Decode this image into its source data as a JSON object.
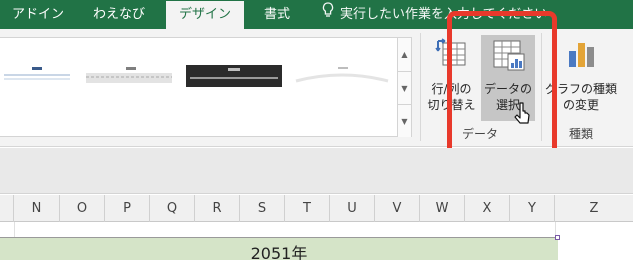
{
  "tabs": [
    {
      "label": "アドイン"
    },
    {
      "label": "わえなび"
    },
    {
      "label": "デザイン"
    },
    {
      "label": "書式"
    }
  ],
  "tell_me": "実行したい作業を入力してください",
  "ribbon": {
    "switch_row_col": "行/列の\n切り替え",
    "select_data": "データの\n選択",
    "change_chart_type": "グラフの種類\nの変更",
    "group_data": "データ",
    "group_type": "種類"
  },
  "columns": [
    "N",
    "O",
    "P",
    "Q",
    "R",
    "S",
    "T",
    "U",
    "V",
    "W",
    "X",
    "Y",
    "Z"
  ],
  "sheet": {
    "cell_text": "2051年"
  },
  "colors": {
    "ribbon_green": "#217346",
    "highlight_red": "#e8392b",
    "cell_fill": "#d5e4c8"
  }
}
